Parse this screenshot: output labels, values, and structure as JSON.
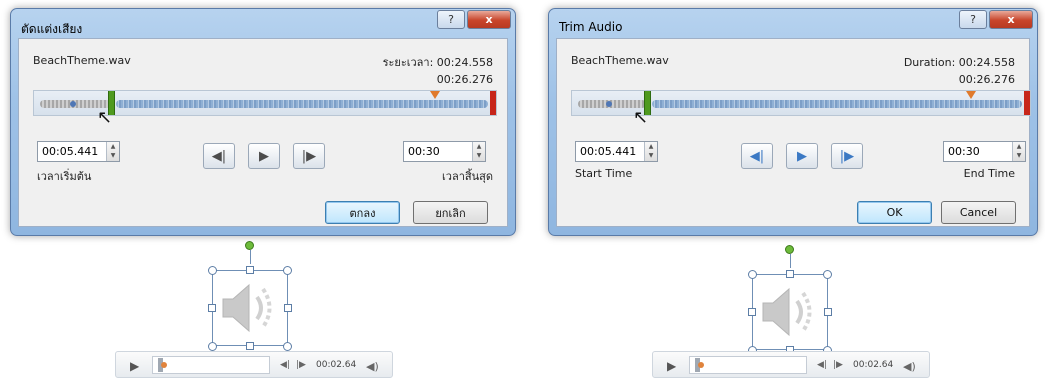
{
  "left_dialog": {
    "title": "ตัดแต่งเสียง",
    "filename": "BeachTheme.wav",
    "duration_label": "ระยะเวลา:",
    "duration_value": "00:24.558",
    "position_value": "00:26.276",
    "start_time_value": "00:05.441",
    "end_time_value": "00:30",
    "start_label": "เวลาเริ่มต้น",
    "end_label": "เวลาสิ้นสุด",
    "ok_label": "ตกลง",
    "cancel_label": "ยกเลิก"
  },
  "right_dialog": {
    "title": "Trim Audio",
    "filename": "BeachTheme.wav",
    "duration_label": "Duration:",
    "duration_value": "00:24.558",
    "position_value": "00:26.276",
    "start_time_value": "00:05.441",
    "end_time_value": "00:30",
    "start_label": "Start Time",
    "end_label": "End Time",
    "ok_label": "OK",
    "cancel_label": "Cancel"
  },
  "players": {
    "left_time": "00:02.64",
    "right_time": "00:02.64"
  },
  "icons": {
    "help": "?",
    "close": "x",
    "prev_frame": "◀|",
    "play": "▶",
    "next_frame": "|▶",
    "speaker": "speaker-icon"
  }
}
